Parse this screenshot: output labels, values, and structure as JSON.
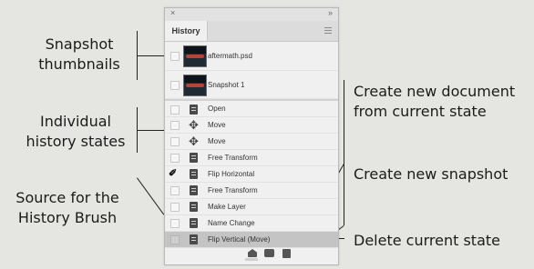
{
  "panel": {
    "close_symbol": "×",
    "collapse_symbol": "»",
    "tab_label": "History",
    "menu_icon": "panel-menu-icon",
    "snapshots": [
      {
        "label": "aftermath.psd",
        "icon": "snapshot-thumbnail"
      },
      {
        "label": "Snapshot 1",
        "icon": "snapshot-thumbnail"
      }
    ],
    "states": [
      {
        "label": "Open",
        "icon": "document-icon",
        "history_brush_source": false
      },
      {
        "label": "Move",
        "icon": "move-icon",
        "history_brush_source": false
      },
      {
        "label": "Move",
        "icon": "move-icon",
        "history_brush_source": false
      },
      {
        "label": "Free Transform",
        "icon": "document-icon",
        "history_brush_source": false
      },
      {
        "label": "Flip Horizontal",
        "icon": "document-icon",
        "history_brush_source": true
      },
      {
        "label": "Free Transform",
        "icon": "document-icon",
        "history_brush_source": false
      },
      {
        "label": "Make Layer",
        "icon": "document-icon",
        "history_brush_source": false
      },
      {
        "label": "Name Change",
        "icon": "document-icon",
        "history_brush_source": false
      },
      {
        "label": "Flip Vertical (Move)",
        "icon": "document-icon",
        "history_brush_source": false,
        "selected": true
      }
    ],
    "bottom_buttons": [
      {
        "icon": "new-document-from-state-icon"
      },
      {
        "icon": "camera-icon"
      },
      {
        "icon": "trash-icon"
      }
    ],
    "colors": {
      "selected_row": "#c4c4c4",
      "panel_bg": "#f0f0f0",
      "page_bg": "#e5e5e1"
    }
  },
  "callouts": {
    "snapshot_thumbnails": [
      "Snapshot",
      "thumbnails"
    ],
    "individual_history_states": [
      "Individual",
      "history states"
    ],
    "history_brush_source": [
      "Source for the",
      "History Brush"
    ],
    "new_document": [
      "Create new document",
      "from current state"
    ],
    "new_snapshot": [
      "Create new snapshot"
    ],
    "delete_state": [
      "Delete current state"
    ]
  }
}
